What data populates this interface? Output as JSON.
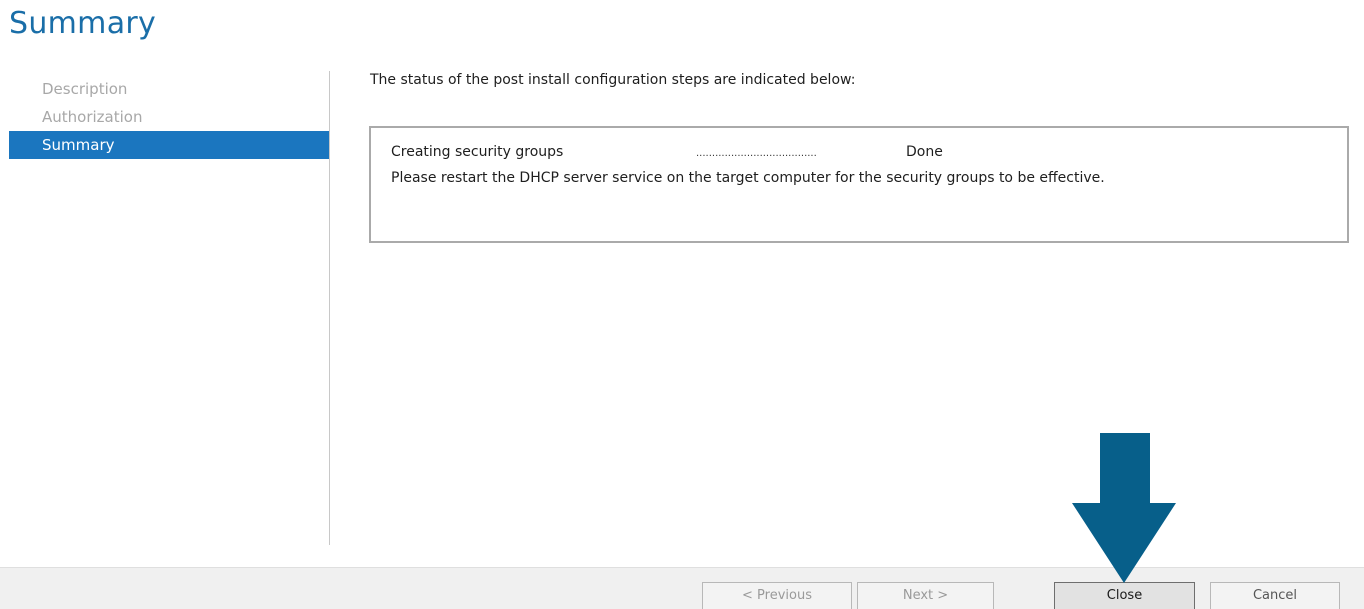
{
  "wizard": {
    "title": "Summary"
  },
  "nav": {
    "items": [
      {
        "label": "Description",
        "active": false
      },
      {
        "label": "Authorization",
        "active": false
      },
      {
        "label": "Summary",
        "active": true
      }
    ]
  },
  "content": {
    "intro": "The status of the post install configuration steps are indicated below:",
    "steps": [
      {
        "name": "Creating security groups",
        "dots": "......................................",
        "status": "Done"
      }
    ],
    "message": "Please restart the DHCP server service on the target computer for the security groups to be effective."
  },
  "footer": {
    "previous_label": "< Previous",
    "next_label": "Next >",
    "close_label": "Close",
    "cancel_label": "Cancel"
  },
  "colors": {
    "accent": "#1b76bf",
    "title": "#1a6ea8",
    "annotation_arrow": "#075f8a"
  },
  "annotation": {
    "icon": "arrow-down-icon"
  }
}
